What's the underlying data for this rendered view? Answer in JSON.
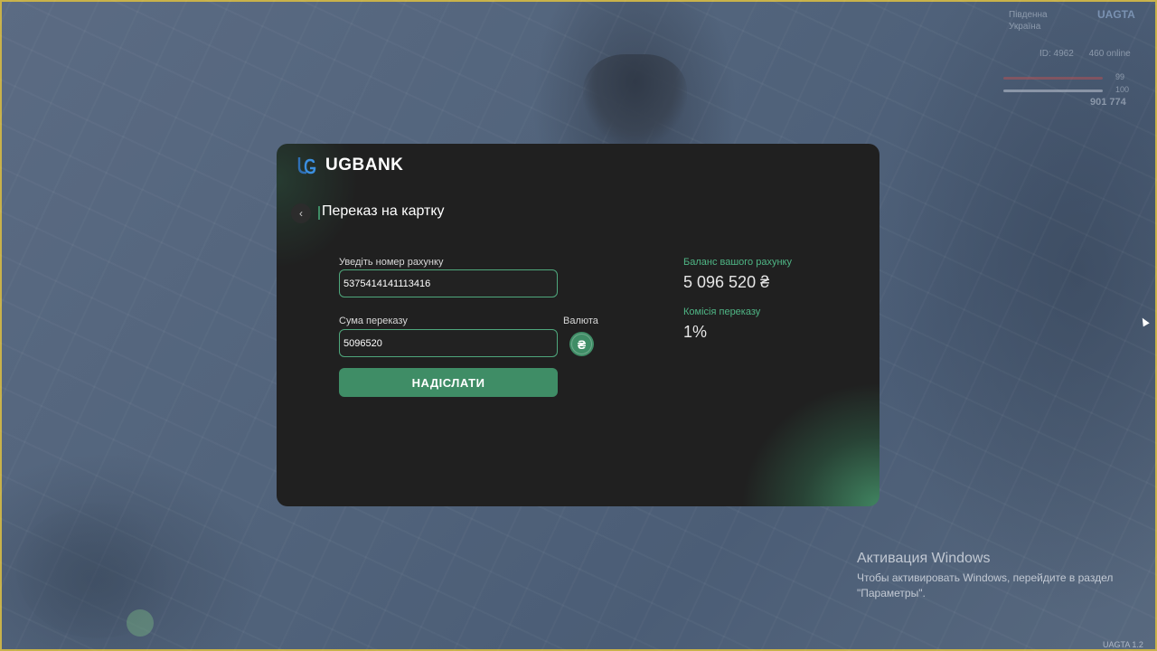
{
  "background": {
    "region_label": "Південна Україна",
    "server_badge": "UAGTA",
    "player_id": "ID: 4962",
    "online_text": "460 online",
    "health": "99",
    "armor": "100",
    "cash": "901 774",
    "version": "UAGTA 1.2"
  },
  "windows_watermark": {
    "title": "Активация Windows",
    "text": "Чтобы активировать Windows, перейдите в раздел \"Параметры\"."
  },
  "bank": {
    "brand_name": "UGBANK",
    "back_icon": "chevron-left-icon",
    "page_title": "Переказ на картку",
    "account_label": "Уведіть номер рахунку",
    "account_value": "5375414141113416",
    "amount_label": "Сума переказу",
    "amount_value": "5096520",
    "currency_label": "Валюта",
    "currency_symbol": "₴",
    "send_label": "НАДІСЛАТИ",
    "balance_label": "Баланс вашого рахунку",
    "balance_value": "5 096 520 ₴",
    "commission_label": "Комісія переказу",
    "commission_value": "1%",
    "accent_color": "#3f8d66",
    "panel_color": "#202020"
  }
}
